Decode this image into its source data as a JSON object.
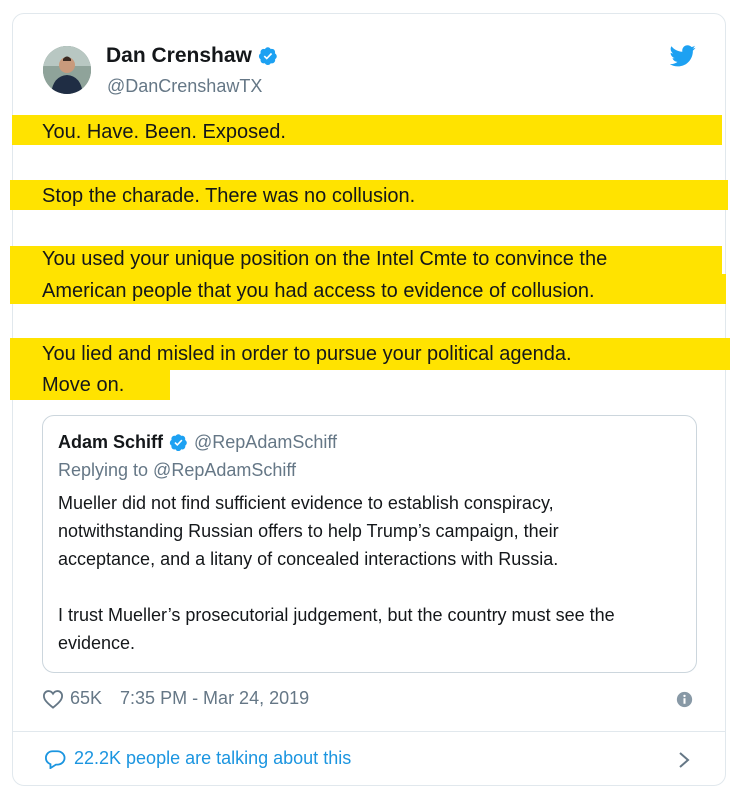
{
  "author": {
    "name": "Dan Crenshaw",
    "handle": "@DanCrenshawTX",
    "verified": true,
    "avatar_icon": "profile-photo"
  },
  "tweet_lines": [
    "You. Have. Been. Exposed.",
    "Stop the charade. There was no collusion.",
    "You used your unique position on the Intel Cmte to convince the",
    "American people that you had access to evidence of collusion.",
    "You lied and misled in order to pursue your political agenda.",
    "Move on."
  ],
  "quoted": {
    "name": "Adam Schiff",
    "handle": "@RepAdamSchiff",
    "replying_to": "Replying to @RepAdamSchiff",
    "lines": [
      "Mueller did not find sufficient evidence to establish conspiracy,",
      "notwithstanding Russian offers to help Trump’s campaign, their",
      "acceptance, and a litany of concealed interactions with Russia.",
      "I trust Mueller’s prosecutorial judgement, but the country must see the",
      "evidence."
    ]
  },
  "meta": {
    "likes": "65K",
    "timestamp": "7:35 PM - Mar 24, 2019"
  },
  "footer": {
    "talking": "22.2K people are talking about this"
  },
  "colors": {
    "highlight": "#ffe300",
    "link_blue": "#1b95e0",
    "secondary_text": "#657786",
    "verified_blue": "#1da1f2"
  }
}
